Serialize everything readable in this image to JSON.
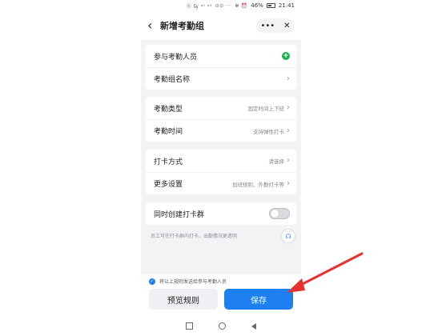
{
  "status_bar": {
    "signal_text": "ⓗ ㏉ ᵃˡˡ ᵃˡˡ",
    "extra_icons": "⊙⊙ ···",
    "bt_alarm": "✻ ⏰",
    "battery_pct": "46%",
    "time": "21:41"
  },
  "header": {
    "title": "新增考勤组",
    "more_label": "•••",
    "close_label": "✕"
  },
  "group1": {
    "participants_label": "参与考勤人员",
    "name_label": "考勤组名称"
  },
  "group2": {
    "type_label": "考勤类型",
    "type_value": "固定时间上下班",
    "time_label": "考勤时间",
    "time_value": "支持弹性打卡"
  },
  "group3": {
    "method_label": "打卡方式",
    "method_value": "请选择",
    "more_label": "更多设置",
    "more_value": "加班规则、外勤打卡等"
  },
  "group4": {
    "create_group_label": "同时创建打卡群",
    "create_group_on": false
  },
  "hint_text": "员工可在打卡群内打卡，出勤情况更透明",
  "bottom": {
    "send_rules_text": "将以上规则发送给参与考勤人员",
    "preview_label": "预览规则",
    "save_label": "保存"
  },
  "colors": {
    "accent": "#1d7ff0",
    "green": "#1aad4b",
    "annotation_red": "#e8312f"
  }
}
